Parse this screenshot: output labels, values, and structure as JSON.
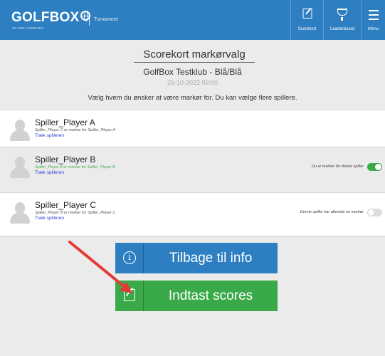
{
  "header": {
    "brand": "GOLFBOX",
    "brand_sub": "AN NGL COMPANY",
    "section": "Turnament",
    "nav": [
      {
        "label": "Scorekort",
        "icon": "scorecard-icon"
      },
      {
        "label": "Leaderboard",
        "icon": "trophy-icon"
      },
      {
        "label": "Menu",
        "icon": "hamburger-icon"
      }
    ],
    "bg_color": "#2d7fc1"
  },
  "page": {
    "title": "Scorekort markørvalg",
    "club": "GolfBox Testklub - Blå/Blå",
    "date": "26-10-2022 09:00",
    "instruction": "Vælg hvem du ønsker at være markør for. Du kan vælge flere spillere."
  },
  "players": [
    {
      "name": "Spiller_Player A",
      "meta": "Spiller_Player C er markør for Spiller_Player A",
      "link": "Træk spilleren",
      "status": "",
      "selected": false
    },
    {
      "name": "Spiller_Player B",
      "meta": "Spiller_Player A er markør for Spiller_Player B",
      "link": "Træk spilleren",
      "status": "Du er markør for denne spiller",
      "selected": true
    },
    {
      "name": "Spiller_Player C",
      "meta": "Spiller_Player B er markør for Spiller_Player C",
      "link": "Træk spilleren",
      "status": "Denne spiller har allerede en markør",
      "selected": false
    }
  ],
  "buttons": {
    "info": "Tilbage til info",
    "scores": "Indtast scores"
  },
  "colors": {
    "primary": "#2d7fc1",
    "success": "#3aa94a",
    "arrow": "#e53935"
  }
}
